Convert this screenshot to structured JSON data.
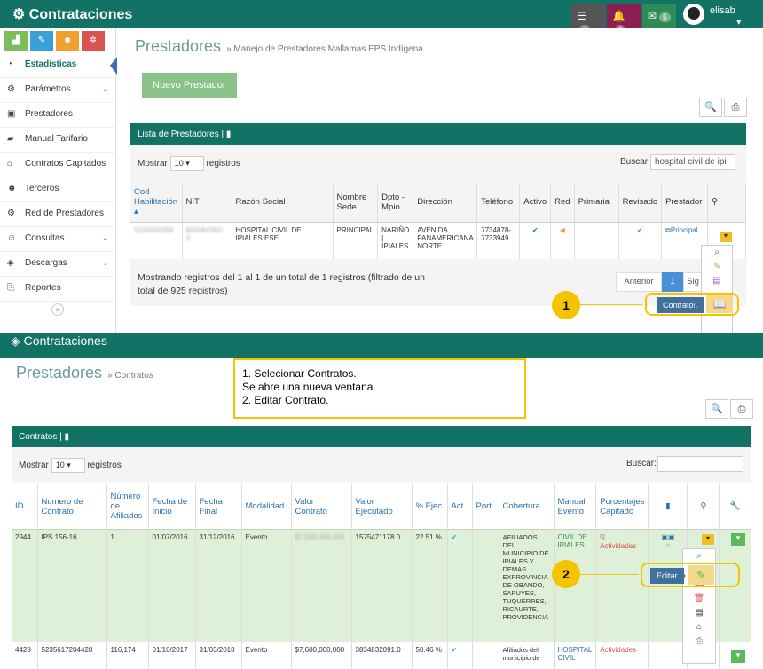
{
  "app": {
    "title": "Contrataciones"
  },
  "topbar": {
    "notif1_count": "4",
    "notif2_count": "8",
    "notif3_count": "5",
    "user": "elisab"
  },
  "sidebar": {
    "items": [
      {
        "label": "Estadísticas",
        "icon": "dashboard-icon"
      },
      {
        "label": "Parámetros",
        "icon": "gears-icon"
      },
      {
        "label": "Prestadores",
        "icon": "hospital-icon"
      },
      {
        "label": "Manual Tarifario",
        "icon": "book-icon"
      },
      {
        "label": "Contratos Capitados",
        "icon": "bank-icon"
      },
      {
        "label": "Terceros",
        "icon": "users-icon"
      },
      {
        "label": "Red de Prestadores",
        "icon": "gears-icon"
      },
      {
        "label": "Consultas",
        "icon": "user-search-icon"
      },
      {
        "label": "Descargas",
        "icon": "cubes-icon"
      },
      {
        "label": "Reportes",
        "icon": "file-icon"
      }
    ],
    "collapse": "«"
  },
  "page1": {
    "title": "Prestadores",
    "subtitle": "» Manejo de Prestadores Mallamas EPS Indígena",
    "new_button": "Nuevo Prestador",
    "panel_title": "Lista de Prestadores |",
    "show_label": "Mostrar",
    "show_value": "10",
    "records_label": "registros",
    "search_label": "Buscar:",
    "search_value": "hospital civil de ipi",
    "headers": [
      "Cod Habilitación",
      "NIT",
      "Razón Social",
      "Nombre Sede",
      "Dpto - Mpio",
      "Dirección",
      "Teléfono",
      "Activo",
      "Red",
      "Primaria",
      "Revisado",
      "Prestador",
      ""
    ],
    "row": {
      "cod": "5235600356",
      "nit": "800084362-3",
      "razon": "HOSPITAL CIVIL DE IPIALES ESE",
      "sede": "PRINCIPAL",
      "dpto": "NARIÑO | IPIALES",
      "direccion": "AVENIDA PANAMERICANA NORTE",
      "telefono": "7734878-7733949",
      "prestador": "Principal"
    },
    "footer": "Mostrando registros del 1 al 1 de un total de 1 registros (filtrado de un total de 925 registros)",
    "pager": {
      "prev": "Anterior",
      "page": "1",
      "next": "Sig"
    },
    "tooltip": "Contratos",
    "callout": "1"
  },
  "page2": {
    "app_title": "Contrataciones",
    "title": "Prestadores",
    "subtitle": "» Contratos",
    "note_lines": [
      "1. Selecionar Contratos.",
      "Se abre una nueva ventana.",
      "2. Editar Contrato."
    ],
    "panel_title": "Contratos |",
    "show_label": "Mostrar",
    "show_value": "10",
    "records_label": "registros",
    "search_label": "Buscar:",
    "headers": [
      "ID",
      "Numero de Contrato",
      "Número de Afiliados",
      "Fecha de Inicio",
      "Fecha Final",
      "Modalidad",
      "Valor Contrato",
      "Valor Ejecutado",
      "% Ejec",
      "Act.",
      "Port.",
      "Cobertura",
      "Manual Evento",
      "Porcentajes Capitado",
      "",
      "",
      ""
    ],
    "rows": [
      {
        "id": "2944",
        "numero": "IPS 156-16",
        "afiliados": "1",
        "inicio": "01/07/2016",
        "final": "31/12/2016",
        "modalidad": "Evento",
        "valor": "$7,000,000,000",
        "ejecutado": "1575471178.0",
        "ejec": "22.51 %",
        "cobertura": "AFILIADOS DEL MUNICIPIO DE IPIALES Y DEMAS EXPROVINCIA DE OBANDO, SAPUYES, TUQUERRES, RICAURTE, PROVIDENCIA",
        "manual": "CIVIL DE IPIALES",
        "porcentajes": "Actividades"
      },
      {
        "id": "4428",
        "numero": "5235617204428",
        "afiliados": "116,174",
        "inicio": "01/10/2017",
        "final": "31/03/2018",
        "modalidad": "Evento",
        "valor": "$7,600,000,000",
        "ejecutado": "3834832091.0",
        "ejec": "50.46 %",
        "cobertura": "Afiliados del municipio de",
        "manual": "HOSPITAL CIVIL",
        "porcentajes": "Actividades"
      }
    ],
    "tooltip": "Editar",
    "callout": "2"
  },
  "colors": {
    "teal": "#127266",
    "callout": "#f5c400"
  }
}
